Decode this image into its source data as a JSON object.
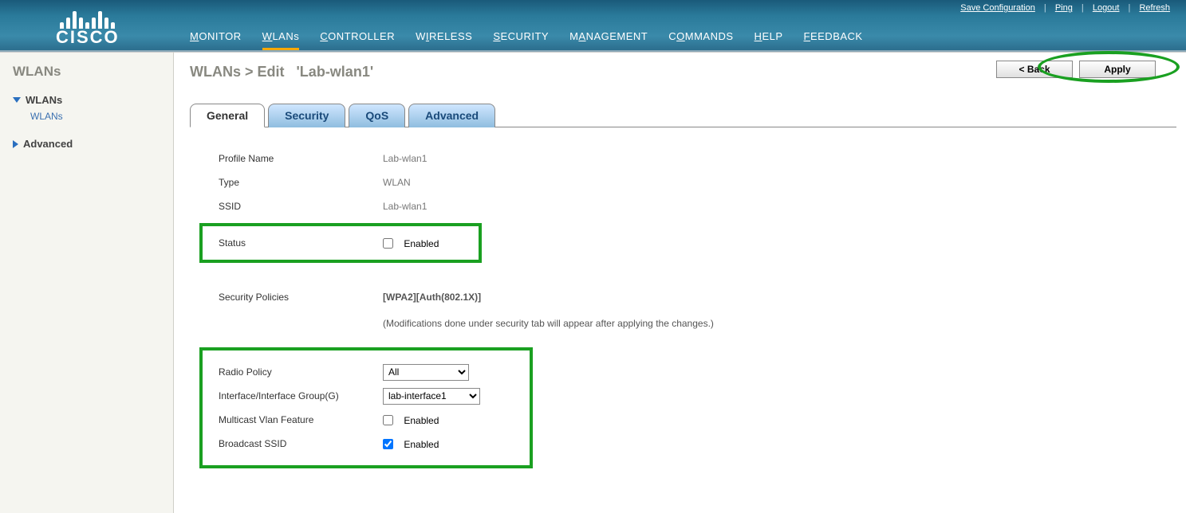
{
  "brand": "CISCO",
  "util_links": {
    "save": "Save Configuration",
    "ping": "Ping",
    "logout": "Logout",
    "refresh": "Refresh"
  },
  "main_nav": [
    {
      "key": "monitor",
      "label": "MONITOR",
      "u": "M"
    },
    {
      "key": "wlans",
      "label": "WLANs",
      "u": "W",
      "active": true
    },
    {
      "key": "controller",
      "label": "CONTROLLER",
      "u": "C"
    },
    {
      "key": "wireless",
      "label": "WIRELESS",
      "u": "W"
    },
    {
      "key": "security",
      "label": "SECURITY",
      "u": "S"
    },
    {
      "key": "management",
      "label": "MANAGEMENT",
      "u": "M"
    },
    {
      "key": "commands",
      "label": "COMMANDS",
      "u": "C"
    },
    {
      "key": "help",
      "label": "HELP",
      "u": "H"
    },
    {
      "key": "feedback",
      "label": "FEEDBACK",
      "u": "F"
    }
  ],
  "sidebar": {
    "title": "WLANs",
    "items": [
      {
        "label": "WLANs",
        "state": "expanded",
        "children": [
          {
            "label": "WLANs"
          }
        ]
      },
      {
        "label": "Advanced",
        "state": "collapsed"
      }
    ]
  },
  "breadcrumb": {
    "path": "WLANs > Edit",
    "itemName": "'Lab-wlan1'"
  },
  "buttons": {
    "back": "< Back",
    "apply": "Apply"
  },
  "tabs": [
    {
      "key": "general",
      "label": "General",
      "active": true
    },
    {
      "key": "security",
      "label": "Security"
    },
    {
      "key": "qos",
      "label": "QoS"
    },
    {
      "key": "advanced",
      "label": "Advanced"
    }
  ],
  "form": {
    "profileName": {
      "label": "Profile Name",
      "value": "Lab-wlan1"
    },
    "type": {
      "label": "Type",
      "value": "WLAN"
    },
    "ssid": {
      "label": "SSID",
      "value": "Lab-wlan1"
    },
    "status": {
      "label": "Status",
      "checkLabel": "Enabled",
      "checked": false
    },
    "securityPolicies": {
      "label": "Security Policies",
      "value": "[WPA2][Auth(802.1X)]",
      "hint": "(Modifications done under security tab will appear after applying the changes.)"
    },
    "radioPolicy": {
      "label": "Radio Policy",
      "value": "All"
    },
    "interfaceGroup": {
      "label": "Interface/Interface Group(G)",
      "value": "lab-interface1"
    },
    "multicastVlan": {
      "label": "Multicast Vlan Feature",
      "checkLabel": "Enabled",
      "checked": false
    },
    "broadcastSsid": {
      "label": "Broadcast SSID",
      "checkLabel": "Enabled",
      "checked": true
    }
  }
}
